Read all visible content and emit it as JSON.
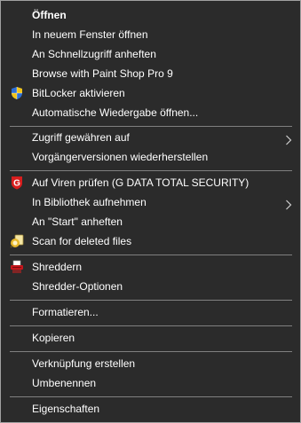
{
  "context_menu": {
    "items": [
      {
        "label": "Öffnen",
        "bold": true
      },
      {
        "label": "In neuem Fenster öffnen"
      },
      {
        "label": "An Schnellzugriff anheften"
      },
      {
        "label": "Browse with Paint Shop Pro 9"
      },
      {
        "label": "BitLocker aktivieren",
        "icon": "uac-shield-icon"
      },
      {
        "label": "Automatische Wiedergabe öffnen..."
      },
      {
        "label": "Zugriff gewähren auf",
        "submenu": true
      },
      {
        "label": "Vorgängerversionen wiederherstellen"
      },
      {
        "label": "Auf Viren prüfen (G DATA TOTAL SECURITY)",
        "icon": "gdata-shield-icon"
      },
      {
        "label": "In Bibliothek aufnehmen",
        "submenu": true
      },
      {
        "label": "An \"Start\" anheften"
      },
      {
        "label": "Scan for deleted files",
        "icon": "recovery-tool-icon"
      },
      {
        "label": "Shreddern",
        "icon": "shredder-icon"
      },
      {
        "label": "Shredder-Optionen"
      },
      {
        "label": "Formatieren..."
      },
      {
        "label": "Kopieren"
      },
      {
        "label": "Verknüpfung erstellen"
      },
      {
        "label": "Umbenennen"
      },
      {
        "label": "Eigenschaften"
      }
    ]
  },
  "colors": {
    "background": "#2b2b2b",
    "text": "#ffffff",
    "separator": "#808080",
    "border": "#a0a0a0"
  }
}
